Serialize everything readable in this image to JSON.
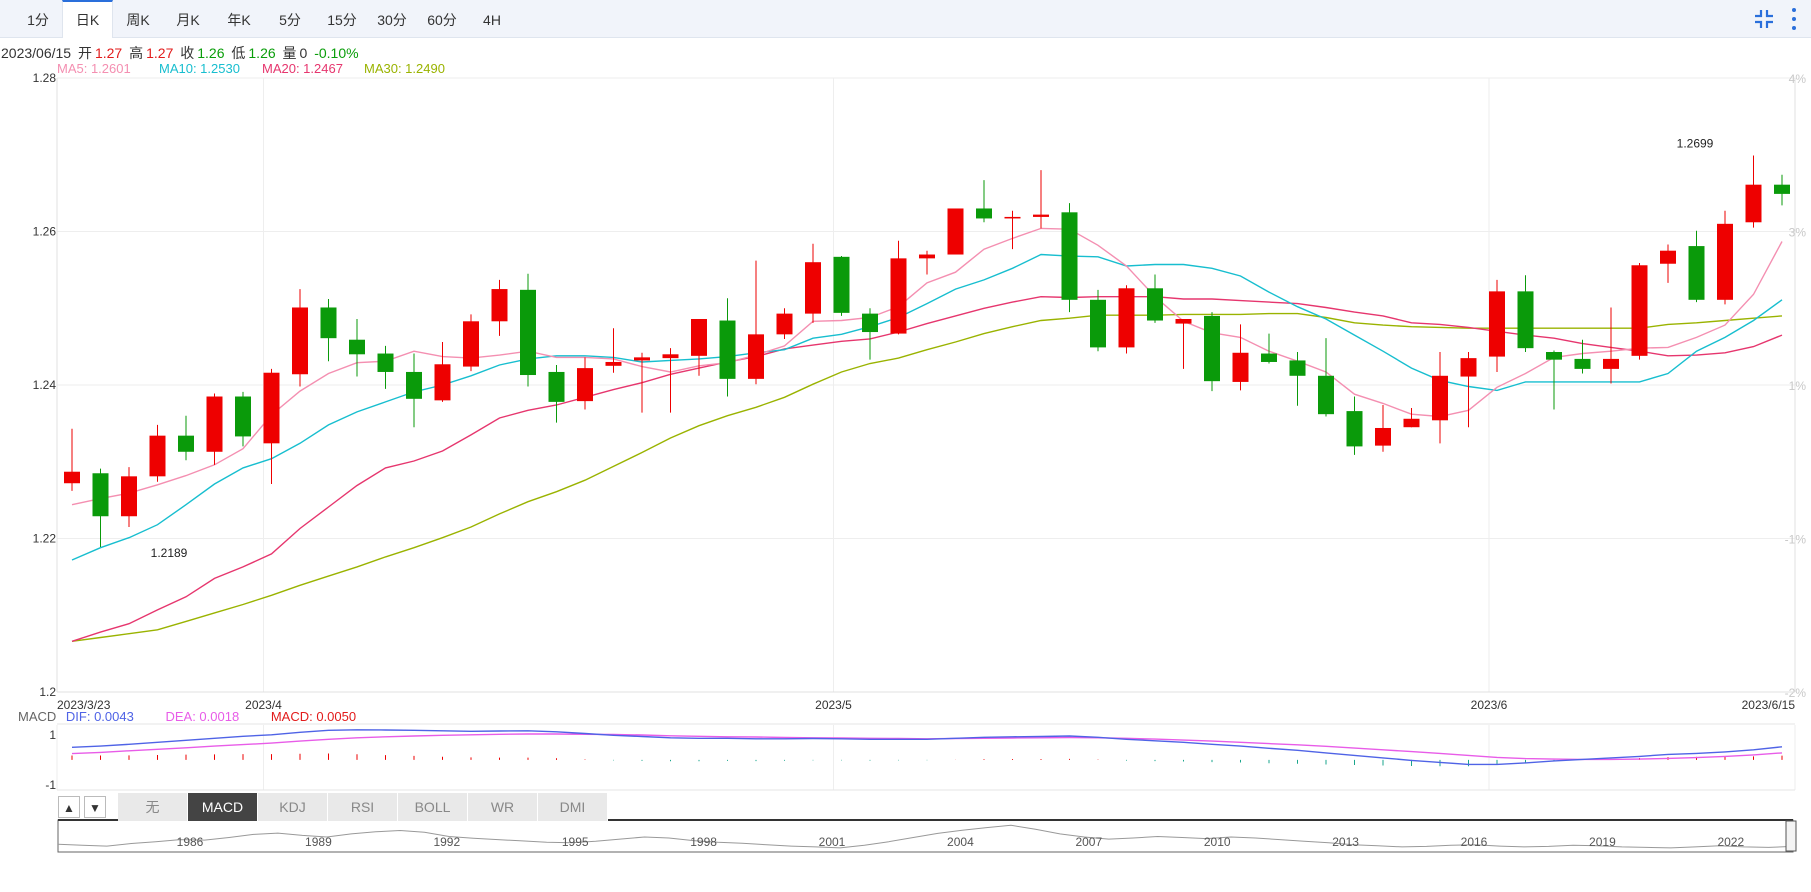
{
  "tabs": [
    {
      "label": "1分",
      "active": false
    },
    {
      "label": "日K",
      "active": true
    },
    {
      "label": "周K",
      "active": false
    },
    {
      "label": "月K",
      "active": false
    },
    {
      "label": "年K",
      "active": false
    },
    {
      "label": "5分",
      "active": false
    },
    {
      "label": "15分",
      "active": false
    },
    {
      "label": "30分",
      "active": false
    },
    {
      "label": "60分",
      "active": false
    },
    {
      "label": "4H",
      "active": false
    }
  ],
  "toolbar": {
    "shrink_icon": "shrink-icon",
    "more_icon": "vertical-dots-icon"
  },
  "info": {
    "date": "2023/06/15",
    "open_label": "开",
    "open": "1.27",
    "high_label": "高",
    "high": "1.27",
    "close_label": "收",
    "close": "1.26",
    "low_label": "低",
    "low": "1.26",
    "vol_label": "量",
    "vol": "0",
    "change": "-0.10%"
  },
  "ma": [
    {
      "text": "MA5: 1.2601",
      "color": "#f48fb1"
    },
    {
      "text": "MA10: 1.2530",
      "color": "#17becf"
    },
    {
      "text": "MA20: 1.2467",
      "color": "#e6366e"
    },
    {
      "text": "MA30: 1.2490",
      "color": "#9ab300"
    }
  ],
  "colors": {
    "up": "#ee0000",
    "down": "#0a9a0a",
    "ma5": "#f48fb1",
    "ma10": "#17becf",
    "ma20": "#e6366e",
    "ma30": "#9ab300",
    "dif": "#4f63e6",
    "dea": "#e85ce8",
    "grid": "#eeeeee",
    "axis_text": "#333333",
    "right_axis_text": "#c8c8c8"
  },
  "chart_data": {
    "type": "candlestick",
    "ylim": [
      1.2,
      1.28
    ],
    "y_ticks": [
      "1.28",
      "1.26",
      "1.24",
      "1.22",
      "1.2"
    ],
    "y_tick_values": [
      1.28,
      1.26,
      1.24,
      1.22,
      1.2
    ],
    "right_ticks": [
      "4%",
      "3%",
      "1%",
      "-1%",
      "-2%"
    ],
    "right_tick_values": [
      1.28,
      1.26,
      1.24,
      1.22,
      1.2
    ],
    "x_labels": [
      "2023/3/23",
      "2023/4",
      "2023/5",
      "2023/6",
      "2023/6/15"
    ],
    "x_label_index": [
      0,
      7,
      27,
      50,
      59
    ],
    "annotations": [
      {
        "text": "1.2189",
        "index": 2,
        "value": 1.2189
      },
      {
        "text": "1.2699",
        "index": 58,
        "value": 1.2699
      }
    ],
    "candles": [
      {
        "o": 1.2272,
        "h": 1.2343,
        "l": 1.2262,
        "c": 1.2287
      },
      {
        "o": 1.2285,
        "h": 1.2291,
        "l": 1.2189,
        "c": 1.2229
      },
      {
        "o": 1.2229,
        "h": 1.2293,
        "l": 1.2215,
        "c": 1.2281
      },
      {
        "o": 1.2281,
        "h": 1.2348,
        "l": 1.2274,
        "c": 1.2334
      },
      {
        "o": 1.2334,
        "h": 1.236,
        "l": 1.2302,
        "c": 1.2313
      },
      {
        "o": 1.2313,
        "h": 1.2389,
        "l": 1.2296,
        "c": 1.2385
      },
      {
        "o": 1.2385,
        "h": 1.2391,
        "l": 1.232,
        "c": 1.2333
      },
      {
        "o": 1.2324,
        "h": 1.2421,
        "l": 1.2271,
        "c": 1.2416
      },
      {
        "o": 1.2414,
        "h": 1.2525,
        "l": 1.2398,
        "c": 1.2501
      },
      {
        "o": 1.2501,
        "h": 1.2512,
        "l": 1.2431,
        "c": 1.2461
      },
      {
        "o": 1.2459,
        "h": 1.2486,
        "l": 1.2411,
        "c": 1.244
      },
      {
        "o": 1.2441,
        "h": 1.2451,
        "l": 1.2395,
        "c": 1.2417
      },
      {
        "o": 1.2417,
        "h": 1.2441,
        "l": 1.2345,
        "c": 1.2382
      },
      {
        "o": 1.238,
        "h": 1.2456,
        "l": 1.2378,
        "c": 1.2427
      },
      {
        "o": 1.2424,
        "h": 1.2492,
        "l": 1.2418,
        "c": 1.2483
      },
      {
        "o": 1.2483,
        "h": 1.2537,
        "l": 1.2464,
        "c": 1.2525
      },
      {
        "o": 1.2524,
        "h": 1.2545,
        "l": 1.2398,
        "c": 1.2413
      },
      {
        "o": 1.2417,
        "h": 1.2426,
        "l": 1.2351,
        "c": 1.2378
      },
      {
        "o": 1.2379,
        "h": 1.2436,
        "l": 1.2368,
        "c": 1.2422
      },
      {
        "o": 1.2425,
        "h": 1.2474,
        "l": 1.2416,
        "c": 1.243
      },
      {
        "o": 1.2432,
        "h": 1.2442,
        "l": 1.2364,
        "c": 1.2436
      },
      {
        "o": 1.2435,
        "h": 1.2448,
        "l": 1.2364,
        "c": 1.244
      },
      {
        "o": 1.2438,
        "h": 1.2484,
        "l": 1.2412,
        "c": 1.2486
      },
      {
        "o": 1.2484,
        "h": 1.2513,
        "l": 1.2385,
        "c": 1.2408
      },
      {
        "o": 1.2408,
        "h": 1.2562,
        "l": 1.2401,
        "c": 1.2466
      },
      {
        "o": 1.2466,
        "h": 1.25,
        "l": 1.246,
        "c": 1.2493
      },
      {
        "o": 1.2493,
        "h": 1.2584,
        "l": 1.2481,
        "c": 1.256
      },
      {
        "o": 1.2567,
        "h": 1.2568,
        "l": 1.249,
        "c": 1.2494
      },
      {
        "o": 1.2493,
        "h": 1.25,
        "l": 1.2433,
        "c": 1.2469
      },
      {
        "o": 1.2467,
        "h": 1.2588,
        "l": 1.2466,
        "c": 1.2565
      },
      {
        "o": 1.2565,
        "h": 1.2575,
        "l": 1.2544,
        "c": 1.257
      },
      {
        "o": 1.257,
        "h": 1.263,
        "l": 1.257,
        "c": 1.263
      },
      {
        "o": 1.263,
        "h": 1.2667,
        "l": 1.2612,
        "c": 1.2617
      },
      {
        "o": 1.2617,
        "h": 1.2627,
        "l": 1.2577,
        "c": 1.2619
      },
      {
        "o": 1.2619,
        "h": 1.268,
        "l": 1.2604,
        "c": 1.2622
      },
      {
        "o": 1.2625,
        "h": 1.2637,
        "l": 1.2495,
        "c": 1.2511
      },
      {
        "o": 1.2511,
        "h": 1.2524,
        "l": 1.2444,
        "c": 1.2449
      },
      {
        "o": 1.2449,
        "h": 1.253,
        "l": 1.2441,
        "c": 1.2526
      },
      {
        "o": 1.2526,
        "h": 1.2544,
        "l": 1.2481,
        "c": 1.2484
      },
      {
        "o": 1.248,
        "h": 1.2486,
        "l": 1.2421,
        "c": 1.2486
      },
      {
        "o": 1.249,
        "h": 1.2495,
        "l": 1.2392,
        "c": 1.2405
      },
      {
        "o": 1.2404,
        "h": 1.2479,
        "l": 1.2393,
        "c": 1.2442
      },
      {
        "o": 1.2441,
        "h": 1.2467,
        "l": 1.2428,
        "c": 1.243
      },
      {
        "o": 1.2432,
        "h": 1.2443,
        "l": 1.2373,
        "c": 1.2412
      },
      {
        "o": 1.2412,
        "h": 1.2461,
        "l": 1.2359,
        "c": 1.2362
      },
      {
        "o": 1.2366,
        "h": 1.2385,
        "l": 1.2309,
        "c": 1.232
      },
      {
        "o": 1.2321,
        "h": 1.2374,
        "l": 1.2313,
        "c": 1.2344
      },
      {
        "o": 1.2345,
        "h": 1.237,
        "l": 1.2345,
        "c": 1.2356
      },
      {
        "o": 1.2354,
        "h": 1.2443,
        "l": 1.2324,
        "c": 1.2412
      },
      {
        "o": 1.2411,
        "h": 1.2443,
        "l": 1.2345,
        "c": 1.2435
      },
      {
        "o": 1.2437,
        "h": 1.2537,
        "l": 1.2417,
        "c": 1.2522
      },
      {
        "o": 1.2522,
        "h": 1.2543,
        "l": 1.2443,
        "c": 1.2448
      },
      {
        "o": 1.2443,
        "h": 1.2445,
        "l": 1.2368,
        "c": 1.2433
      },
      {
        "o": 1.2434,
        "h": 1.2459,
        "l": 1.2415,
        "c": 1.2421
      },
      {
        "o": 1.2421,
        "h": 1.2501,
        "l": 1.2402,
        "c": 1.2434
      },
      {
        "o": 1.2438,
        "h": 1.2559,
        "l": 1.2433,
        "c": 1.2556
      },
      {
        "o": 1.2558,
        "h": 1.2583,
        "l": 1.2533,
        "c": 1.2575
      },
      {
        "o": 1.2581,
        "h": 1.2601,
        "l": 1.2508,
        "c": 1.2511
      },
      {
        "o": 1.2511,
        "h": 1.2627,
        "l": 1.2505,
        "c": 1.261
      },
      {
        "o": 1.2612,
        "h": 1.2699,
        "l": 1.2605,
        "c": 1.2661
      },
      {
        "o": 1.2661,
        "h": 1.2674,
        "l": 1.2634,
        "c": 1.2649
      }
    ],
    "ma5": [
      1.2244,
      1.2252,
      1.2259,
      1.227,
      1.2282,
      1.2296,
      1.2317,
      1.2361,
      1.2392,
      1.2415,
      1.2429,
      1.2431,
      1.2444,
      1.2437,
      1.2435,
      1.2439,
      1.2444,
      1.2436,
      1.2436,
      1.2434,
      1.2424,
      1.2417,
      1.2425,
      1.2429,
      1.2439,
      1.2451,
      1.2483,
      1.2484,
      1.2488,
      1.2502,
      1.2533,
      1.2547,
      1.2577,
      1.2591,
      1.2604,
      1.2603,
      1.2582,
      1.2555,
      1.2515,
      1.2483,
      1.2468,
      1.2462,
      1.2444,
      1.2431,
      1.2417,
      1.2388,
      1.2376,
      1.2362,
      1.2359,
      1.2367,
      1.2397,
      1.2415,
      1.2436,
      1.2441,
      1.2444,
      1.2448,
      1.2449,
      1.2462,
      1.2478,
      1.2518,
      1.2587
    ],
    "ma10": [
      1.2172,
      1.2188,
      1.2201,
      1.2218,
      1.2244,
      1.2271,
      1.2292,
      1.2304,
      1.2324,
      1.2348,
      1.2365,
      1.2378,
      1.2391,
      1.24,
      1.2412,
      1.2426,
      1.2434,
      1.2438,
      1.2438,
      1.2436,
      1.243,
      1.2432,
      1.2434,
      1.2437,
      1.2442,
      1.2446,
      1.2461,
      1.2466,
      1.2476,
      1.2488,
      1.2506,
      1.2525,
      1.2537,
      1.2552,
      1.257,
      1.2568,
      1.2567,
      1.2555,
      1.2557,
      1.2557,
      1.2552,
      1.2542,
      1.2521,
      1.2502,
      1.2486,
      1.2465,
      1.2444,
      1.2422,
      1.2406,
      1.2398,
      1.2393,
      1.2404,
      1.2404,
      1.2404,
      1.2404,
      1.2404,
      1.2415,
      1.2444,
      1.2462,
      1.2484,
      1.2511
    ],
    "ma20": [
      1.2066,
      1.2078,
      1.2089,
      1.2107,
      1.2124,
      1.2148,
      1.2163,
      1.218,
      1.2213,
      1.2241,
      1.2269,
      1.2292,
      1.2301,
      1.2314,
      1.2335,
      1.2357,
      1.2367,
      1.2374,
      1.2384,
      1.2394,
      1.2403,
      1.2414,
      1.2422,
      1.243,
      1.2437,
      1.2447,
      1.2452,
      1.2457,
      1.246,
      1.2469,
      1.248,
      1.249,
      1.25,
      1.2508,
      1.2515,
      1.2514,
      1.2515,
      1.2515,
      1.2515,
      1.2512,
      1.2512,
      1.251,
      1.2508,
      1.2506,
      1.2501,
      1.2495,
      1.249,
      1.2481,
      1.2479,
      1.2475,
      1.247,
      1.2465,
      1.2461,
      1.2454,
      1.2449,
      1.2444,
      1.2438,
      1.2439,
      1.2442,
      1.245,
      1.2465
    ],
    "ma30": [
      1.2066,
      1.2071,
      1.2076,
      1.2081,
      1.2092,
      1.2103,
      1.2114,
      1.2126,
      1.2139,
      1.2151,
      1.2163,
      1.2176,
      1.2188,
      1.2201,
      1.2215,
      1.2232,
      1.2248,
      1.2261,
      1.2276,
      1.2294,
      1.2312,
      1.2331,
      1.2347,
      1.236,
      1.2371,
      1.2384,
      1.2401,
      1.2417,
      1.2428,
      1.2435,
      1.2446,
      1.2456,
      1.2467,
      1.2476,
      1.2484,
      1.2487,
      1.2491,
      1.2491,
      1.2491,
      1.2492,
      1.2492,
      1.2492,
      1.2493,
      1.2493,
      1.2488,
      1.2481,
      1.2478,
      1.2476,
      1.2475,
      1.2474,
      1.2474,
      1.2474,
      1.2474,
      1.2474,
      1.2474,
      1.2474,
      1.2479,
      1.2481,
      1.2484,
      1.2487,
      1.249
    ],
    "macd": {
      "label": "MACD",
      "dif_label": "DIF: 0.0043",
      "dea_label": "DEA: 0.0018",
      "macd_label": "MACD: 0.0050",
      "y_ticks": [
        "1",
        "-1"
      ],
      "y_tick_values": [
        1,
        -1
      ],
      "ylim": [
        -1.2,
        1.35
      ],
      "dif": [
        0.5,
        0.55,
        0.62,
        0.7,
        0.78,
        0.86,
        0.94,
        1.0,
        1.1,
        1.18,
        1.2,
        1.19,
        1.18,
        1.16,
        1.14,
        1.15,
        1.16,
        1.12,
        1.05,
        0.98,
        0.93,
        0.88,
        0.86,
        0.86,
        0.84,
        0.84,
        0.85,
        0.84,
        0.82,
        0.82,
        0.82,
        0.86,
        0.9,
        0.92,
        0.93,
        0.95,
        0.9,
        0.82,
        0.76,
        0.7,
        0.62,
        0.55,
        0.46,
        0.38,
        0.28,
        0.18,
        0.08,
        -0.02,
        -0.1,
        -0.18,
        -0.18,
        -0.12,
        -0.04,
        0.02,
        0.08,
        0.14,
        0.22,
        0.26,
        0.32,
        0.4,
        0.52
      ],
      "dea": [
        0.25,
        0.3,
        0.36,
        0.42,
        0.48,
        0.55,
        0.61,
        0.67,
        0.75,
        0.82,
        0.88,
        0.92,
        0.95,
        0.98,
        1.0,
        1.02,
        1.03,
        1.03,
        1.02,
        1.01,
        0.99,
        0.96,
        0.94,
        0.92,
        0.91,
        0.89,
        0.88,
        0.87,
        0.86,
        0.85,
        0.84,
        0.85,
        0.86,
        0.87,
        0.88,
        0.89,
        0.88,
        0.86,
        0.83,
        0.79,
        0.75,
        0.7,
        0.65,
        0.6,
        0.54,
        0.47,
        0.4,
        0.33,
        0.26,
        0.18,
        0.1,
        0.05,
        0.03,
        0.02,
        0.02,
        0.03,
        0.06,
        0.09,
        0.14,
        0.2,
        0.28
      ],
      "hist": [
        0.5,
        0.5,
        0.52,
        0.56,
        0.6,
        0.62,
        0.66,
        0.66,
        0.7,
        0.72,
        0.64,
        0.54,
        0.46,
        0.36,
        0.28,
        0.26,
        0.26,
        0.18,
        0.06,
        -0.06,
        -0.12,
        -0.16,
        -0.16,
        -0.12,
        -0.14,
        -0.1,
        -0.06,
        -0.06,
        -0.08,
        -0.06,
        -0.04,
        0.02,
        0.08,
        0.1,
        0.1,
        0.12,
        0.04,
        -0.08,
        -0.14,
        -0.18,
        -0.26,
        -0.3,
        -0.38,
        -0.44,
        -0.52,
        -0.58,
        -0.64,
        -0.7,
        -0.72,
        -0.72,
        -0.56,
        -0.34,
        -0.14,
        0.0,
        0.12,
        0.22,
        0.32,
        0.34,
        0.36,
        0.4,
        0.48
      ]
    },
    "macd_tabs": [
      "无",
      "MACD",
      "KDJ",
      "RSI",
      "BOLL",
      "WR",
      "DMI"
    ],
    "macd_tab_active": 1,
    "navigator": {
      "years": [
        "1986",
        "1989",
        "1992",
        "1995",
        "1998",
        "2001",
        "2004",
        "2007",
        "2010",
        "2013",
        "2016",
        "2019",
        "2022"
      ],
      "series": [
        1.32,
        1.28,
        1.25,
        1.35,
        1.42,
        1.5,
        1.48,
        1.58,
        1.7,
        1.75,
        1.66,
        1.6,
        1.72,
        1.8,
        1.85,
        1.78,
        1.62,
        1.55,
        1.5,
        1.45,
        1.4,
        1.38,
        1.44,
        1.52,
        1.6,
        1.56,
        1.46,
        1.4,
        1.36,
        1.3,
        1.25,
        1.22,
        1.18,
        1.28,
        1.42,
        1.58,
        1.74,
        1.86,
        1.96,
        2.05,
        1.9,
        1.72,
        1.6,
        1.52,
        1.56,
        1.62,
        1.58,
        1.54,
        1.6,
        1.56,
        1.5,
        1.44,
        1.38,
        1.3,
        1.26,
        1.22,
        1.24,
        1.28,
        1.3,
        1.25,
        1.22,
        1.24,
        1.28,
        1.26,
        1.22,
        1.2,
        1.18,
        1.22,
        1.26,
        1.22,
        1.2,
        1.24
      ]
    }
  }
}
